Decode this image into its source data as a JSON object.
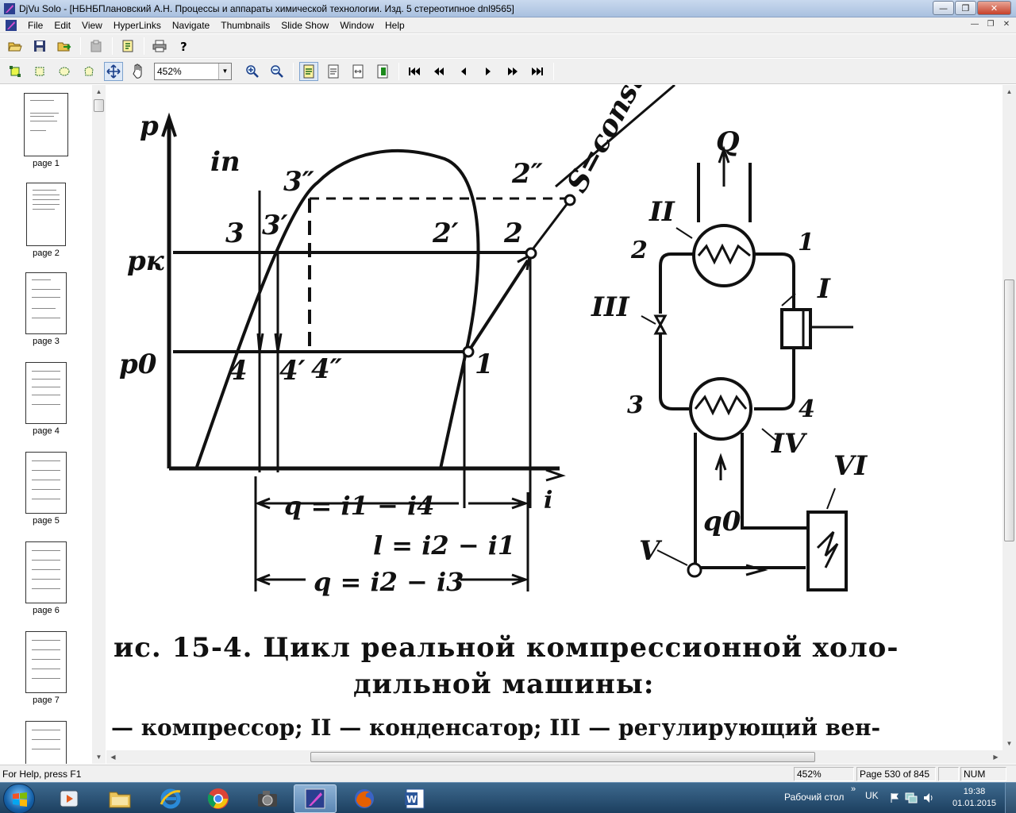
{
  "window": {
    "title": "DjVu Solo - [НБНБПлановский А.Н. Процессы и аппараты химической технологии. Изд. 5 стереотипное dnl9565]",
    "min_glyph": "—",
    "max_glyph": "❐",
    "close_glyph": "✕"
  },
  "menu": {
    "items": [
      "File",
      "Edit",
      "View",
      "HyperLinks",
      "Navigate",
      "Thumbnails",
      "Slide Show",
      "Window",
      "Help"
    ],
    "mdi_min": "—",
    "mdi_restore": "❐",
    "mdi_close": "✕"
  },
  "toolbar": {
    "zoom_value": "452%"
  },
  "thumbnails": {
    "pages": [
      {
        "label": "page 1"
      },
      {
        "label": "page 2"
      },
      {
        "label": "page 3"
      },
      {
        "label": "page 4"
      },
      {
        "label": "page 5"
      },
      {
        "label": "page 6"
      },
      {
        "label": "page 7"
      }
    ]
  },
  "document": {
    "diagram_labels": {
      "p": "p",
      "pk": "pк",
      "p0": "p0",
      "i_axis": "i",
      "in": "iп",
      "s_const": "S=const",
      "pt3": "3",
      "pt3p": "3′",
      "pt3pp": "3″",
      "pt2pp": "2″",
      "pt2p": "2′",
      "pt2": "2",
      "pt1": "1",
      "pt4": "4",
      "pt4p": "4′",
      "pt4pp": "4″",
      "q1": "q = i1 − i4",
      "l": "l = i2 − i1",
      "q2": "q = i2 − i3",
      "Q": "Q",
      "II": "II",
      "III": "III",
      "I": "I",
      "IV": "IV",
      "V": "V",
      "VI": "VI",
      "q0": "q0",
      "s1": "1",
      "s2": "2",
      "s3": "3",
      "s4": "4"
    },
    "caption_line1": "ис. 15-4. Цикл реальной компрессионной холо-",
    "caption_line2": "дильной машины:",
    "legend_line": "— компрессор; II — конденсатор; III — регулирующий вен-"
  },
  "status": {
    "help_text": "For Help, press F1",
    "zoom": "452%",
    "page": "Page 530 of 845",
    "num": "NUM"
  },
  "taskbar": {
    "desktop_label": "Рабочий стол",
    "chevron": "»",
    "lang": "UK",
    "time": "19:38",
    "date": "01.01.2015"
  }
}
